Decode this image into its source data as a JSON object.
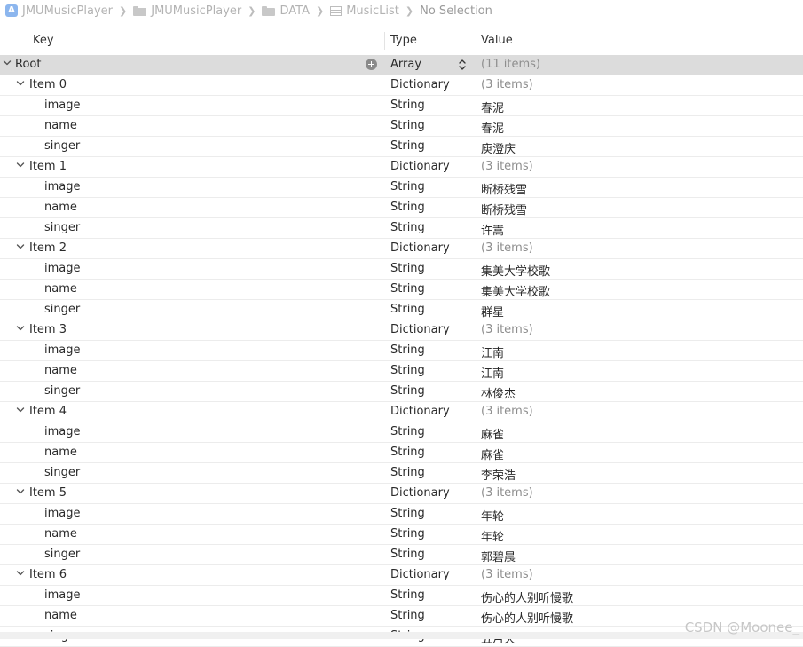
{
  "breadcrumb": [
    {
      "label": "JMUMusicPlayer",
      "icon": "app-icon"
    },
    {
      "label": "JMUMusicPlayer",
      "icon": "folder-icon"
    },
    {
      "label": "DATA",
      "icon": "folder-icon"
    },
    {
      "label": "MusicList",
      "icon": "plist-table-icon"
    },
    {
      "label": "No Selection",
      "icon": ""
    }
  ],
  "columns": {
    "key": "Key",
    "type": "Type",
    "value": "Value"
  },
  "root": {
    "key": "Root",
    "type": "Array",
    "value": "(11 items)"
  },
  "items": [
    {
      "key": "Item 0",
      "type": "Dictionary",
      "value": "(3 items)",
      "children": [
        {
          "key": "image",
          "type": "String",
          "value": "春泥"
        },
        {
          "key": "name",
          "type": "String",
          "value": "春泥"
        },
        {
          "key": "singer",
          "type": "String",
          "value": "庾澄庆"
        }
      ]
    },
    {
      "key": "Item 1",
      "type": "Dictionary",
      "value": "(3 items)",
      "children": [
        {
          "key": "image",
          "type": "String",
          "value": "断桥残雪"
        },
        {
          "key": "name",
          "type": "String",
          "value": "断桥残雪"
        },
        {
          "key": "singer",
          "type": "String",
          "value": "许嵩"
        }
      ]
    },
    {
      "key": "Item 2",
      "type": "Dictionary",
      "value": "(3 items)",
      "children": [
        {
          "key": "image",
          "type": "String",
          "value": "集美大学校歌"
        },
        {
          "key": "name",
          "type": "String",
          "value": "集美大学校歌"
        },
        {
          "key": "singer",
          "type": "String",
          "value": "群星"
        }
      ]
    },
    {
      "key": "Item 3",
      "type": "Dictionary",
      "value": "(3 items)",
      "children": [
        {
          "key": "image",
          "type": "String",
          "value": "江南"
        },
        {
          "key": "name",
          "type": "String",
          "value": "江南"
        },
        {
          "key": "singer",
          "type": "String",
          "value": "林俊杰"
        }
      ]
    },
    {
      "key": "Item 4",
      "type": "Dictionary",
      "value": "(3 items)",
      "children": [
        {
          "key": "image",
          "type": "String",
          "value": "麻雀"
        },
        {
          "key": "name",
          "type": "String",
          "value": "麻雀"
        },
        {
          "key": "singer",
          "type": "String",
          "value": "李荣浩"
        }
      ]
    },
    {
      "key": "Item 5",
      "type": "Dictionary",
      "value": "(3 items)",
      "children": [
        {
          "key": "image",
          "type": "String",
          "value": "年轮"
        },
        {
          "key": "name",
          "type": "String",
          "value": "年轮"
        },
        {
          "key": "singer",
          "type": "String",
          "value": "郭碧晨"
        }
      ]
    },
    {
      "key": "Item 6",
      "type": "Dictionary",
      "value": "(3 items)",
      "children": [
        {
          "key": "image",
          "type": "String",
          "value": "伤心的人别听慢歌"
        },
        {
          "key": "name",
          "type": "String",
          "value": "伤心的人别听慢歌"
        },
        {
          "key": "singer",
          "type": "String",
          "value": "五月天"
        }
      ]
    }
  ],
  "watermark": "CSDN @Moonee_"
}
